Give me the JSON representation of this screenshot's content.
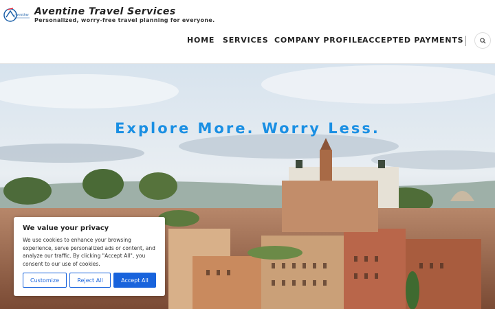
{
  "header": {
    "site_title": "Aventine Travel Services",
    "tagline": "Personalized, worry-free travel planning for everyone.",
    "logo_text": "Aventine"
  },
  "nav": {
    "items": [
      {
        "label": "HOME"
      },
      {
        "label": "SERVICES"
      },
      {
        "label": "COMPANY PROFILE"
      },
      {
        "label": "ACCEPTED PAYMENTS"
      }
    ],
    "search_icon": "search-icon"
  },
  "hero": {
    "headline": "Explore More. Worry Less."
  },
  "cookie_banner": {
    "title": "We value your privacy",
    "body": "We use cookies to enhance your browsing experience, serve personalized ads or content, and analyze our traffic. By clicking \"Accept All\", you consent to our use of cookies.",
    "customize_label": "Customize",
    "reject_label": "Reject All",
    "accept_label": "Accept All"
  },
  "colors": {
    "accent": "#1a8fe3",
    "button_blue": "#1863dc"
  }
}
